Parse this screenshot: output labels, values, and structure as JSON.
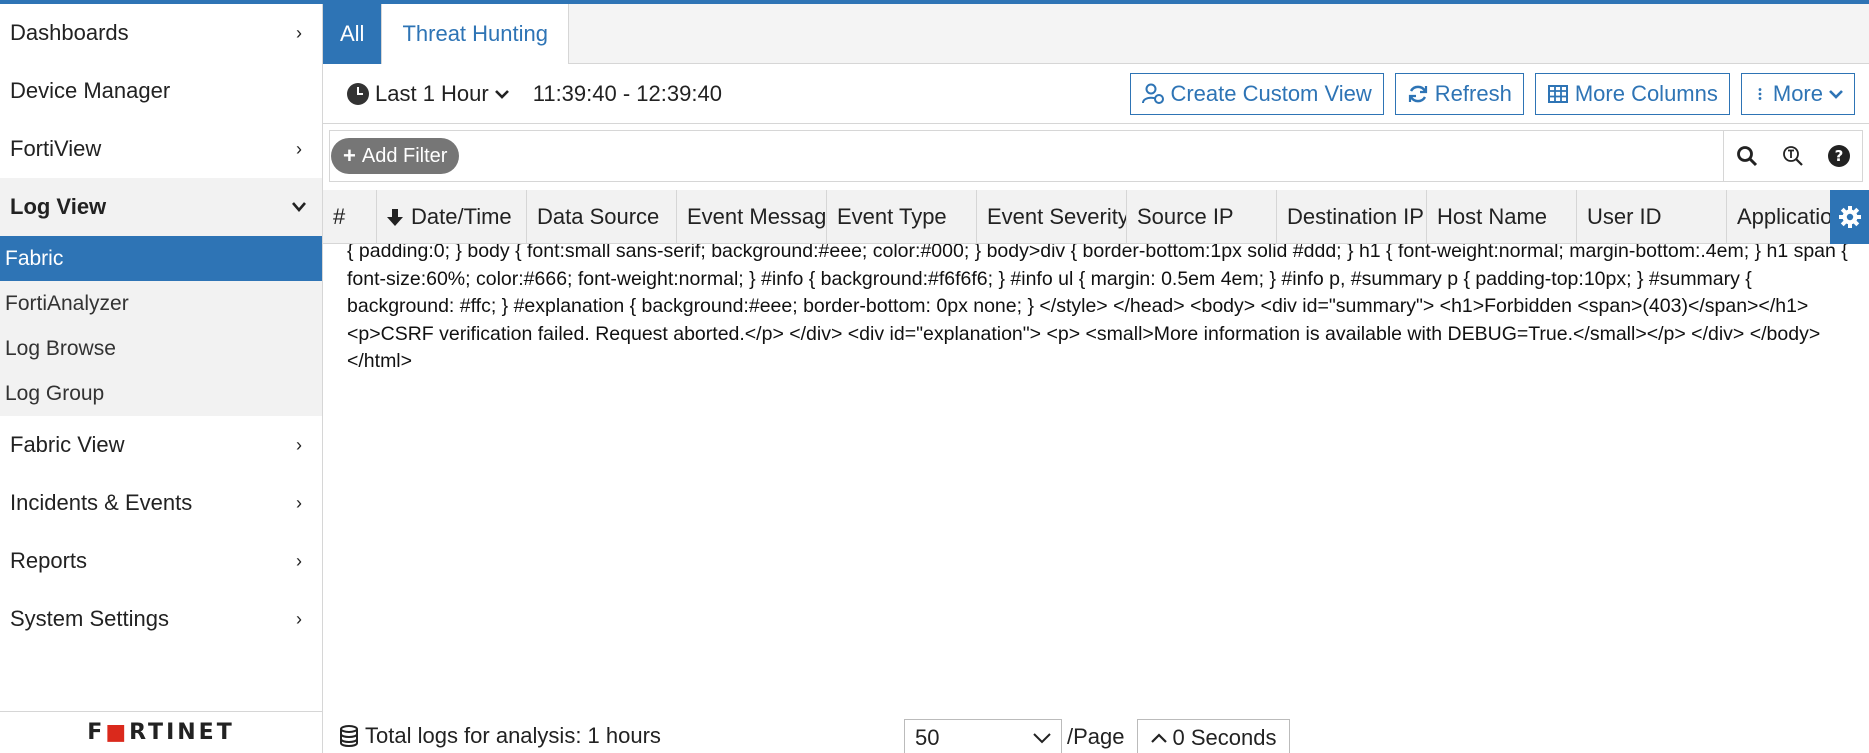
{
  "sidebar": {
    "items": [
      {
        "label": "Dashboards",
        "chevron": "›"
      },
      {
        "label": "Device Manager",
        "chevron": ""
      },
      {
        "label": "FortiView",
        "chevron": "›"
      },
      {
        "label": "Log View",
        "chevron": "⌄"
      },
      {
        "label": "Fabric View",
        "chevron": "›"
      },
      {
        "label": "Incidents & Events",
        "chevron": "›"
      },
      {
        "label": "Reports",
        "chevron": "›"
      },
      {
        "label": "System Settings",
        "chevron": "›"
      }
    ],
    "log_view_sub": [
      "Fabric",
      "FortiAnalyzer",
      "Log Browse",
      "Log Group"
    ],
    "logo": {
      "pre": "F",
      "o": "",
      "post": "RTINET"
    }
  },
  "tabs": [
    "All",
    "Threat Hunting"
  ],
  "toolbar": {
    "time_select": "Last 1 Hour",
    "time_range": "11:39:40 - 12:39:40",
    "buttons": [
      "Create Custom View",
      "Refresh",
      "More Columns",
      "More"
    ]
  },
  "filter": {
    "add_label": "Add Filter",
    "placeholder": ""
  },
  "columns": [
    "#",
    "Date/Time",
    "Data Source",
    "Event Message",
    "Event Type",
    "Event Severity",
    "Source IP",
    "Destination IP",
    "Host Name",
    "User ID",
    "Application"
  ],
  "log_text": "{ padding:0; } body { font:small sans-serif; background:#eee; color:#000; } body>div { border-bottom:1px solid #ddd; } h1 { font-weight:normal; margin-bottom:.4em; } h1 span { font-size:60%; color:#666; font-weight:normal; } #info { background:#f6f6f6; } #info ul { margin: 0.5em 4em; } #info p, #summary p { padding-top:10px; } #summary { background: #ffc; } #explanation { background:#eee; border-bottom: 0px none; } </style> </head> <body> <div id=\"summary\"> <h1>Forbidden <span>(403)</span></h1> <p>CSRF verification failed. Request aborted.</p> </div> <div id=\"explanation\"> <p> <small>More information is available with DEBUG=True.</small></p> </div> </body> </html>",
  "footer": {
    "total": "Total logs for analysis: 1 hours",
    "page_size": "50",
    "per_page": "/Page",
    "refresh": "0 Seconds"
  },
  "colors": {
    "accent": "#2e74b5",
    "logo_red": "#da291c"
  }
}
